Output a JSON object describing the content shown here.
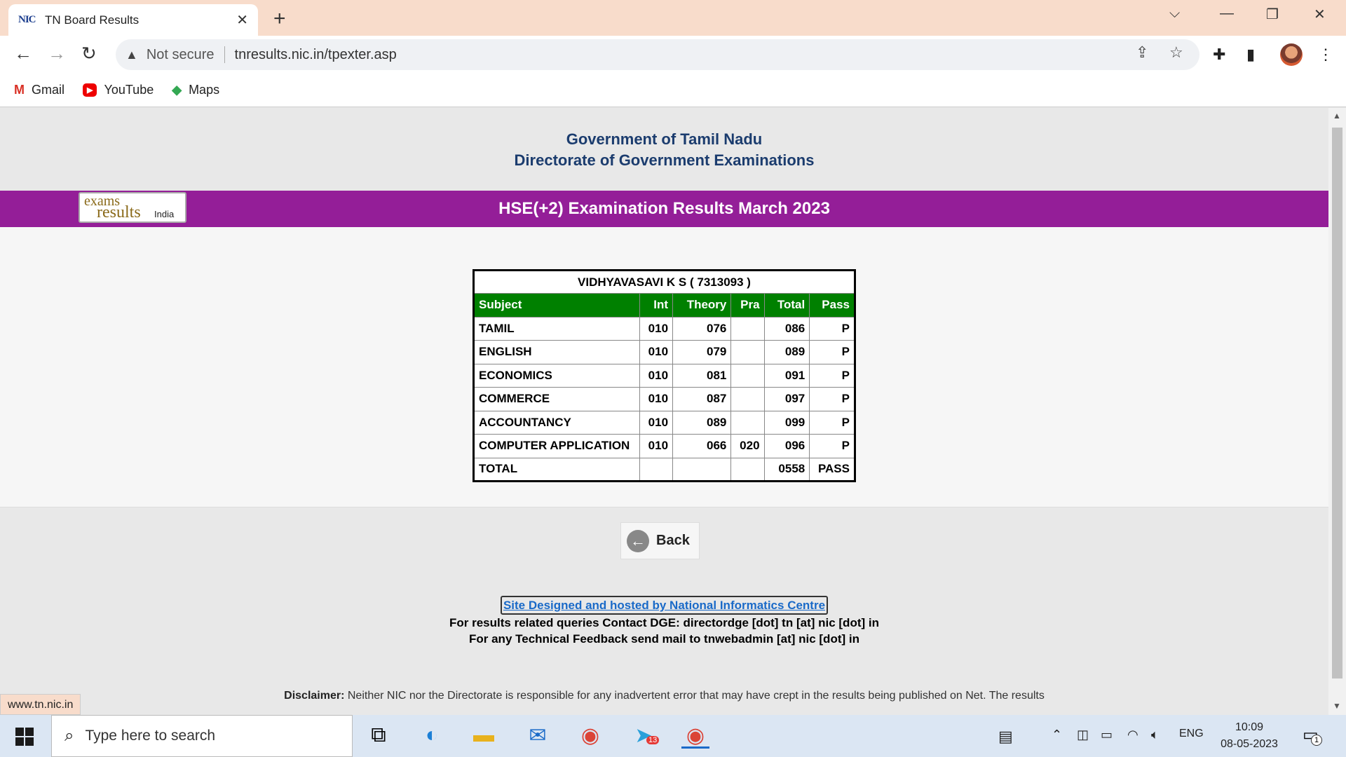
{
  "browser": {
    "tab_icon_text": "NIC",
    "tab_title": "TN Board Results",
    "close_glyph": "✕",
    "newtab_glyph": "+",
    "security_text": "Not secure",
    "url": "tnresults.nic.in/tpexter.asp",
    "bookmarks": [
      {
        "label": "Gmail",
        "icon": "gmail-icon"
      },
      {
        "label": "YouTube",
        "icon": "youtube-icon"
      },
      {
        "label": "Maps",
        "icon": "maps-icon"
      }
    ],
    "status_url": "www.tn.nic.in"
  },
  "page": {
    "gov_line1": "Government of Tamil Nadu",
    "gov_line2": "Directorate of Government Examinations",
    "logo": {
      "l1": "exams",
      "l2": "results",
      "l3": "India"
    },
    "banner_title": "HSE(+2)  Examination Results  March 2023",
    "student_line": "VIDHYAVASAVI K S     ( 7313093 )",
    "headers": [
      "Subject",
      "Int",
      "Theory",
      "Pra",
      "Total",
      "Pass"
    ],
    "rows": [
      [
        "TAMIL",
        "010",
        "076",
        "",
        "086",
        "P"
      ],
      [
        "ENGLISH",
        "010",
        "079",
        "",
        "089",
        "P"
      ],
      [
        "ECONOMICS",
        "010",
        "081",
        "",
        "091",
        "P"
      ],
      [
        "COMMERCE",
        "010",
        "087",
        "",
        "097",
        "P"
      ],
      [
        "ACCOUNTANCY",
        "010",
        "089",
        "",
        "099",
        "P"
      ],
      [
        "COMPUTER APPLICATION",
        "010",
        "066",
        "020",
        "096",
        "P"
      ],
      [
        "TOTAL",
        "",
        "",
        "",
        "0558",
        "PASS"
      ]
    ],
    "back_label": "Back",
    "nic_link": "Site Designed and hosted by National Informatics Centre",
    "contact1": "For results related queries Contact DGE:  directordge [dot] tn [at] nic [dot] in",
    "contact2": "For any Technical Feedback send mail to tnwebadmin [at] nic [dot] in",
    "disclaimer_label": "Disclaimer:",
    "disclaimer_text": "Neither NIC nor the Directorate is responsible for any inadvertent error that may have crept in the results being published on Net. The results"
  },
  "taskbar": {
    "search_placeholder": "Type here to search",
    "telegram_badge": "13",
    "lang": "ENG",
    "time": "10:09",
    "date": "08-05-2023",
    "notif_count": "1"
  },
  "colors": {
    "banner": "#941e98",
    "table_header": "#008000",
    "gov_title": "#1b3c6e",
    "link": "#1a6ac8"
  }
}
